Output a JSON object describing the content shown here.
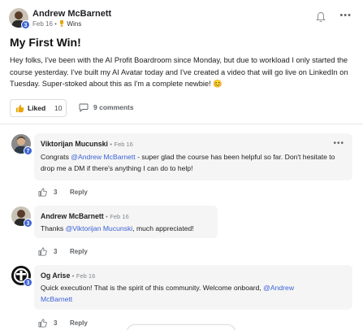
{
  "post": {
    "author": "Andrew McBarnett",
    "level": "3",
    "date": "Feb 16",
    "separator": "•",
    "category": "Wins",
    "title": "My First Win!",
    "body": "Hey folks, I've been with the AI Profit Boardroom since Monday, but due to workload I only started the course yesterday. I've built my AI Avatar today and I've created a video that will go live on LinkedIn on Tuesday. Super-stoked about this as I'm a complete newbie! 😊",
    "like_label": "Liked",
    "like_count": "10",
    "comments_label": "9 comments",
    "more_icon": "•••"
  },
  "comments": [
    {
      "author": "Viktorijan Mucunski",
      "level": "7",
      "date": "Feb 16",
      "text_before": "Congrats ",
      "mention": "@Andrew McBarnett",
      "text_after": " - super glad the course has been helpful so far. Don't hesitate to drop me a DM if there's anything I can do to help!",
      "likes": "3",
      "reply_label": "Reply",
      "more_icon": "•••"
    },
    {
      "author": "Andrew McBarnett",
      "level": "3",
      "date": "Feb 16",
      "text_before": "Thanks ",
      "mention": "@Viktorijan Mucunski",
      "text_after": ", much appreciated!",
      "likes": "3",
      "reply_label": "Reply"
    },
    {
      "author": "Og Arise",
      "level": "3",
      "date": "Feb 16",
      "text_before": "Quick execution! That is the spirit of this community. Welcome onboard, ",
      "mention": "@Andrew McBarnett",
      "text_after": "",
      "likes": "3",
      "reply_label": "Reply"
    }
  ],
  "colors": {
    "accent": "#3b62d6",
    "like_icon": "#e8a400",
    "bubble": "#f5f5f5"
  },
  "icons": [
    "bell-icon",
    "more-icon",
    "trophy-icon",
    "thumbs-up-icon",
    "comment-icon"
  ]
}
